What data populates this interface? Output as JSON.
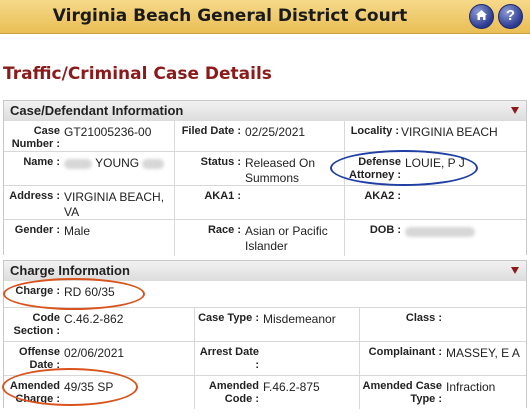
{
  "header": {
    "title": "Virginia Beach General District Court",
    "home_icon": "home-icon",
    "help_icon": "help-icon"
  },
  "page": {
    "title": "Traffic/Criminal Case Details"
  },
  "case_section": {
    "title": "Case/Defendant Information",
    "case_number_label": "Case Number :",
    "case_number": "GT21005236-00",
    "filed_date_label": "Filed Date :",
    "filed_date": "02/25/2021",
    "locality_label": "Locality :",
    "locality": "VIRGINIA BEACH",
    "name_label": "Name :",
    "name": "YOUNG",
    "status_label": "Status :",
    "status": "Released On Summons",
    "defense_label": "Defense Attorney :",
    "defense": "LOUIE, P J",
    "address_label": "Address :",
    "address": "VIRGINIA BEACH, VA",
    "aka1_label": "AKA1 :",
    "aka2_label": "AKA2 :",
    "gender_label": "Gender :",
    "gender": "Male",
    "race_label": "Race :",
    "race": "Asian or Pacific Islander",
    "dob_label": "DOB :"
  },
  "charge_section": {
    "title": "Charge Information",
    "charge_label": "Charge :",
    "charge": "RD 60/35",
    "code_section_label": "Code Section :",
    "code_section": "C.46.2-862",
    "case_type_label": "Case Type :",
    "case_type": "Misdemeanor",
    "class_label": "Class :",
    "offense_date_label": "Offense Date :",
    "offense_date": "02/06/2021",
    "arrest_date_label": "Arrest Date :",
    "complainant_label": "Complainant :",
    "complainant": "MASSEY, E A",
    "amended_charge_label": "Amended Charge :",
    "amended_charge": "49/35 SP",
    "amended_code_label": "Amended Code :",
    "amended_code": "F.46.2-875",
    "amended_case_type_label": "Amended Case Type :",
    "amended_case_type": "Infraction"
  },
  "colors": {
    "title_red": "#8b1a1a",
    "header_gold": "#e9be55",
    "annotation_blue": "#1f3fa3",
    "annotation_red": "#d9531e"
  }
}
